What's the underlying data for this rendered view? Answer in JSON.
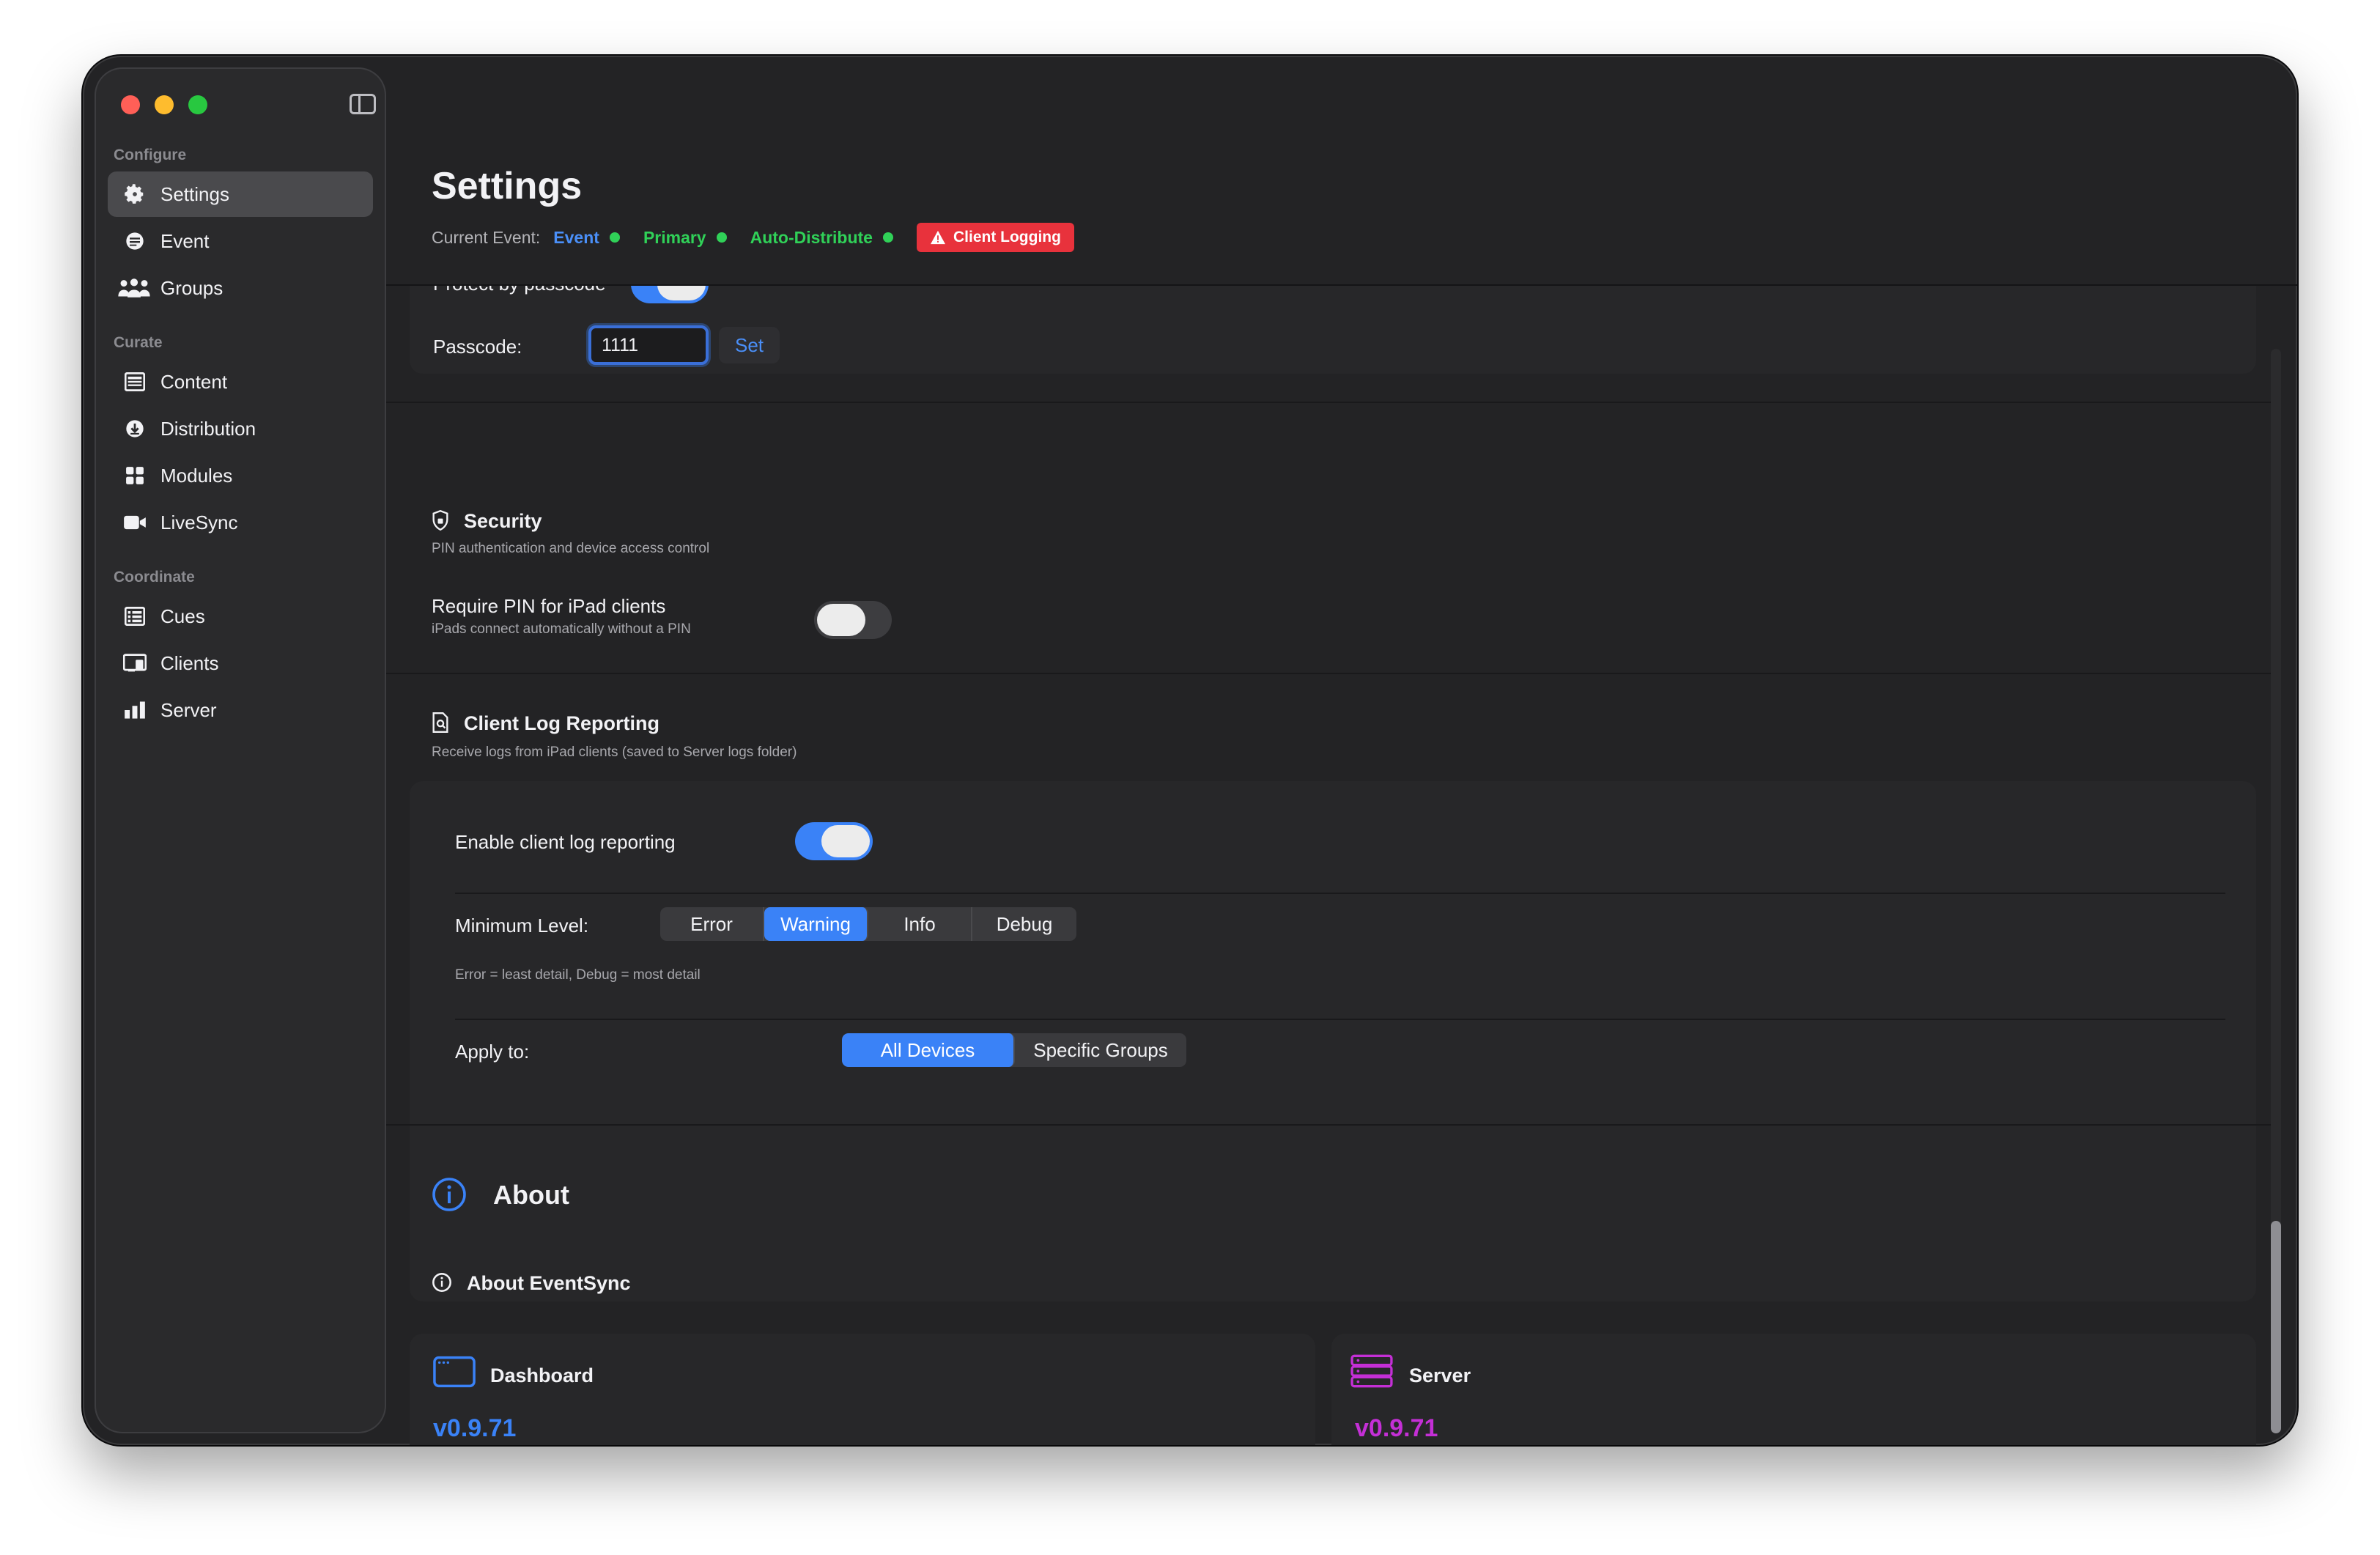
{
  "colors": {
    "accent": "#3a82f7",
    "event": "#4a8ff8",
    "status_green": "#30d158",
    "warning_badge": "#e8323c",
    "server_purple": "#c42fd6"
  },
  "sidebar": {
    "sections": [
      {
        "title": "Configure",
        "items": [
          {
            "label": "Settings",
            "icon": "gear-icon",
            "active": true
          },
          {
            "label": "Event",
            "icon": "calendar-icon"
          },
          {
            "label": "Groups",
            "icon": "people-icon"
          }
        ]
      },
      {
        "title": "Curate",
        "items": [
          {
            "label": "Content",
            "icon": "content-icon"
          },
          {
            "label": "Distribution",
            "icon": "download-icon"
          },
          {
            "label": "Modules",
            "icon": "grid-icon"
          },
          {
            "label": "LiveSync",
            "icon": "video-icon"
          }
        ]
      },
      {
        "title": "Coordinate",
        "items": [
          {
            "label": "Cues",
            "icon": "list-icon"
          },
          {
            "label": "Clients",
            "icon": "clients-icon"
          },
          {
            "label": "Server",
            "icon": "bar-chart-icon"
          }
        ]
      }
    ]
  },
  "header": {
    "title": "Settings",
    "current_event_label": "Current Event:",
    "event": "Event",
    "primary": "Primary",
    "auto_distribute": "Auto-Distribute",
    "badge": "Client Logging"
  },
  "passcode": {
    "protect_label": "Protect by passcode",
    "protect_on": true,
    "label": "Passcode:",
    "value": "1111",
    "set_button": "Set"
  },
  "security": {
    "title": "Security",
    "description": "PIN authentication and device access control",
    "require_pin_label": "Require PIN for iPad clients",
    "require_pin_help": "iPads connect automatically without a PIN",
    "require_pin_on": false
  },
  "client_log": {
    "title": "Client Log Reporting",
    "description": "Receive logs from iPad clients (saved to Server logs folder)",
    "enable_label": "Enable client log reporting",
    "enable_on": true,
    "min_level_label": "Minimum Level:",
    "levels": [
      "Error",
      "Warning",
      "Info",
      "Debug"
    ],
    "selected_level": "Warning",
    "level_help": "Error = least detail, Debug = most detail",
    "apply_label": "Apply to:",
    "apply_options": [
      "All Devices",
      "Specific Groups"
    ],
    "selected_apply": "All Devices"
  },
  "about": {
    "title": "About",
    "subtitle": "About EventSync",
    "dashboard_label": "Dashboard",
    "dashboard_version": "v0.9.71",
    "server_label": "Server",
    "server_version": "v0.9.71"
  }
}
